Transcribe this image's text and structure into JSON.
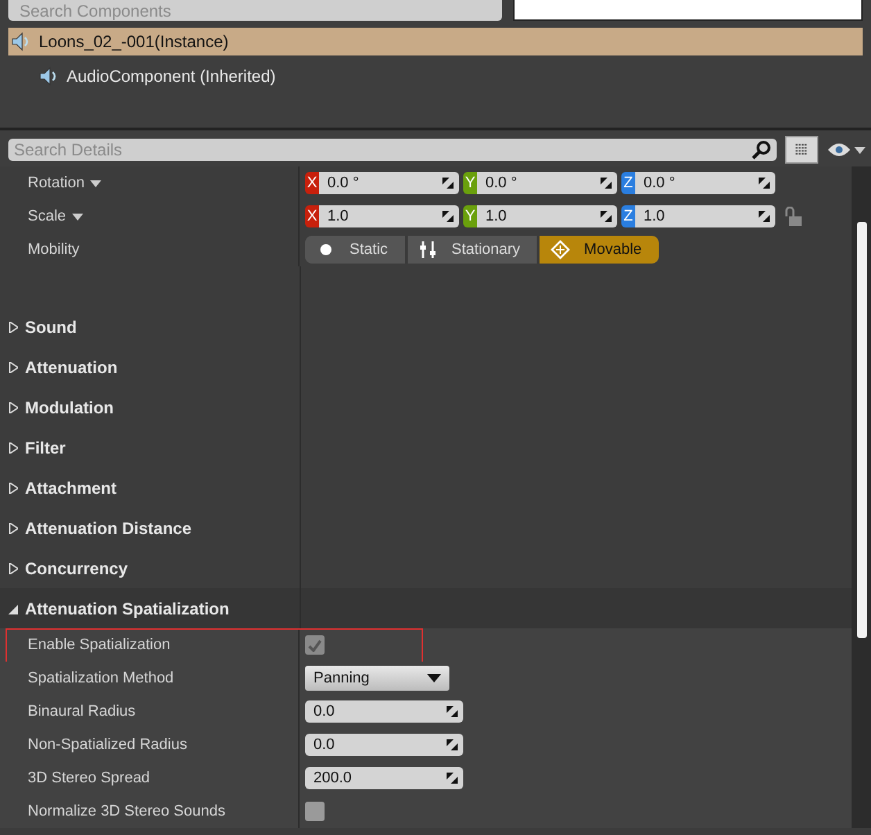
{
  "components_panel": {
    "search": {
      "placeholder": "Search Components"
    },
    "tree": [
      {
        "label": "Loons_02_-001(Instance)",
        "selected": true,
        "children": [
          {
            "label": "AudioComponent (Inherited)",
            "selected": false
          }
        ]
      }
    ]
  },
  "details_panel": {
    "search": {
      "placeholder": "Search Details"
    },
    "transform_rows": [
      {
        "kind": "vector",
        "label": "Rotation",
        "values": [
          {
            "axis": "X",
            "color": "#c8200c",
            "value": "0.0 °"
          },
          {
            "axis": "Y",
            "color": "#6aa00c",
            "value": "0.0 °"
          },
          {
            "axis": "Z",
            "color": "#2a7ee0",
            "value": "0.0 °"
          }
        ]
      },
      {
        "kind": "vector",
        "label": "Scale",
        "locked": false,
        "values": [
          {
            "axis": "X",
            "color": "#c8200c",
            "value": "1.0"
          },
          {
            "axis": "Y",
            "color": "#6aa00c",
            "value": "1.0"
          },
          {
            "axis": "Z",
            "color": "#2a7ee0",
            "value": "1.0"
          }
        ]
      },
      {
        "kind": "segmented",
        "label": "Mobility",
        "options": [
          {
            "label": "Static",
            "selected": false
          },
          {
            "label": "Stationary",
            "selected": false
          },
          {
            "label": "Movable",
            "selected": true
          }
        ]
      }
    ],
    "categories": [
      {
        "label": "Sound",
        "expanded": false
      },
      {
        "label": "Attenuation",
        "expanded": false
      },
      {
        "label": "Modulation",
        "expanded": false
      },
      {
        "label": "Filter",
        "expanded": false
      },
      {
        "label": "Attachment",
        "expanded": false
      },
      {
        "label": "Attenuation Distance",
        "expanded": false
      },
      {
        "label": "Concurrency",
        "expanded": false
      },
      {
        "label": "Attenuation Spatialization",
        "expanded": true,
        "properties": [
          {
            "kind": "checkbox",
            "label": "Enable Spatialization",
            "checked": true,
            "highlighted": true
          },
          {
            "kind": "dropdown",
            "label": "Spatialization Method",
            "value": "Panning"
          },
          {
            "kind": "number",
            "label": "Binaural Radius",
            "value": "0.0"
          },
          {
            "kind": "number",
            "label": "Non-Spatialized Radius",
            "value": "0.0"
          },
          {
            "kind": "number",
            "label": "3D Stereo Spread",
            "value": "200.0"
          },
          {
            "kind": "checkbox",
            "label": "Normalize 3D Stereo Sounds",
            "checked": false
          }
        ]
      }
    ]
  }
}
